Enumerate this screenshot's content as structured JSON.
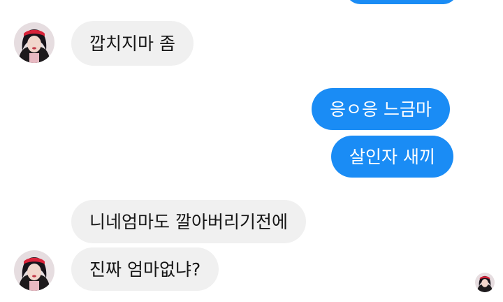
{
  "conversation": {
    "messages": [
      {
        "sender": "other",
        "text": "깝치지마 좀"
      },
      {
        "sender": "me",
        "text": "응ㅇ응 느금마"
      },
      {
        "sender": "me",
        "text": "살인자 새끼"
      },
      {
        "sender": "other",
        "text": "니네엄마도 깔아버리기전에"
      },
      {
        "sender": "other",
        "text": "진짜 엄마없냐?"
      }
    ]
  },
  "colors": {
    "outgoing_bubble": "#1a8cf5",
    "incoming_bubble": "#f0f0f0",
    "incoming_text": "#161616",
    "outgoing_text": "#ffffff"
  },
  "icons": {
    "contact_avatar": "profile-photo-avatar",
    "seen_indicator": "seen-avatar"
  }
}
